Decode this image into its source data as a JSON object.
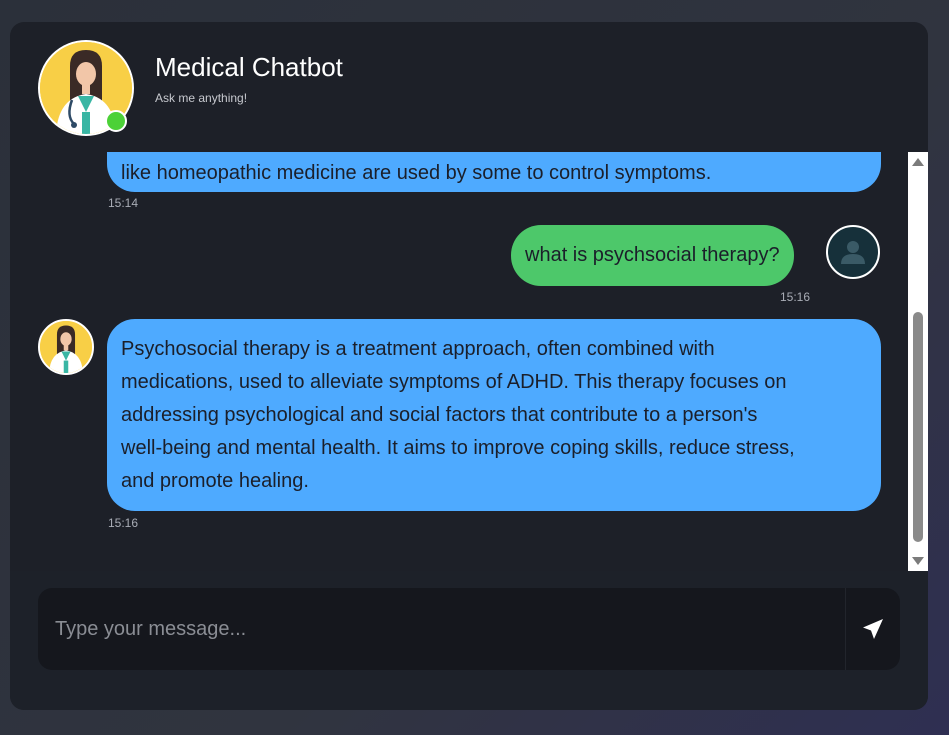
{
  "header": {
    "title": "Medical Chatbot",
    "subtitle": "Ask me anything!"
  },
  "messages": [
    {
      "sender": "bot",
      "text": "like homeopathic medicine are used by some to control symptoms.",
      "time": "15:14"
    },
    {
      "sender": "user",
      "text": "what is psychsocial therapy?",
      "time": "15:16"
    },
    {
      "sender": "bot",
      "lines": [
        "Psychosocial therapy is a treatment approach, often combined with",
        "medications, used to alleviate symptoms of ADHD. This therapy focuses on",
        "addressing psychological and social factors that contribute to a person's",
        "well-being and mental health. It aims to improve coping skills, reduce stress,",
        "and promote healing."
      ],
      "time": "15:16"
    }
  ],
  "input": {
    "placeholder": "Type your message..."
  },
  "icons": {
    "send": "paper-plane-icon",
    "user": "user-icon",
    "bot": "doctor-avatar"
  },
  "colors": {
    "bot_bubble": "#4eaaff",
    "user_bubble": "#4dc86a",
    "online": "#4cd137",
    "background": "#1d2028"
  }
}
